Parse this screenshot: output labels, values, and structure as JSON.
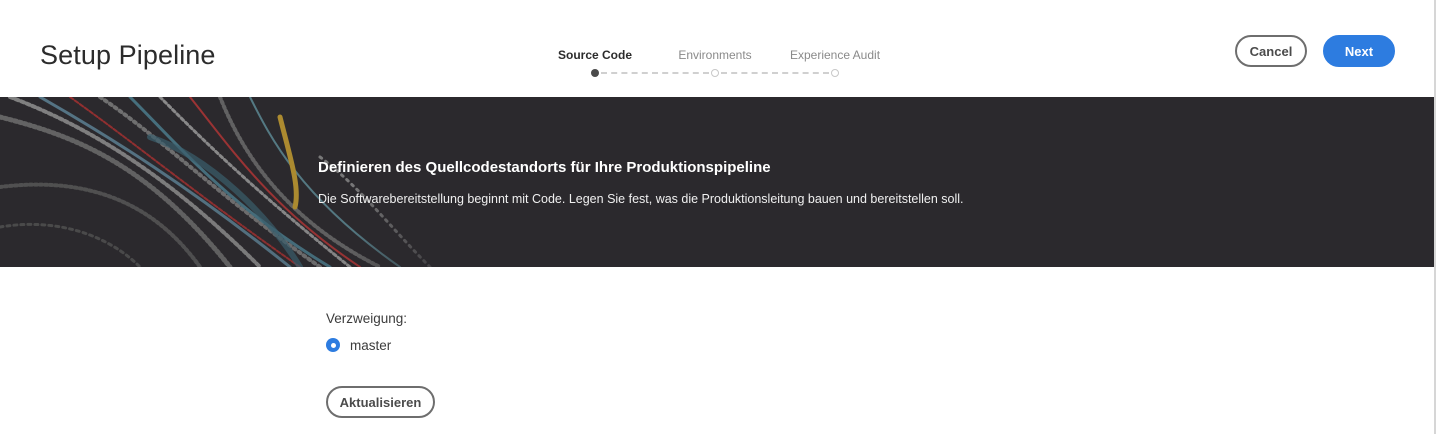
{
  "header": {
    "title": "Setup Pipeline",
    "steps": [
      {
        "label": "Source Code",
        "state": "active"
      },
      {
        "label": "Environments",
        "state": "inactive"
      },
      {
        "label": "Experience Audit",
        "state": "inactive"
      }
    ],
    "cancel_label": "Cancel",
    "next_label": "Next"
  },
  "banner": {
    "title": "Definieren des Quellcodestandorts für Ihre Produktionspipeline",
    "subtitle": "Die Softwarebereitstellung beginnt mit Code. Legen Sie fest, was die Produktionsleitung bauen und bereitstellen soll."
  },
  "form": {
    "branch_label": "Verzweigung:",
    "branch_options": [
      {
        "label": "master",
        "selected": true
      }
    ],
    "update_label": "Aktualisieren"
  },
  "colors": {
    "accent": "#2d7ce0",
    "banner_bg": "#2b292d"
  }
}
